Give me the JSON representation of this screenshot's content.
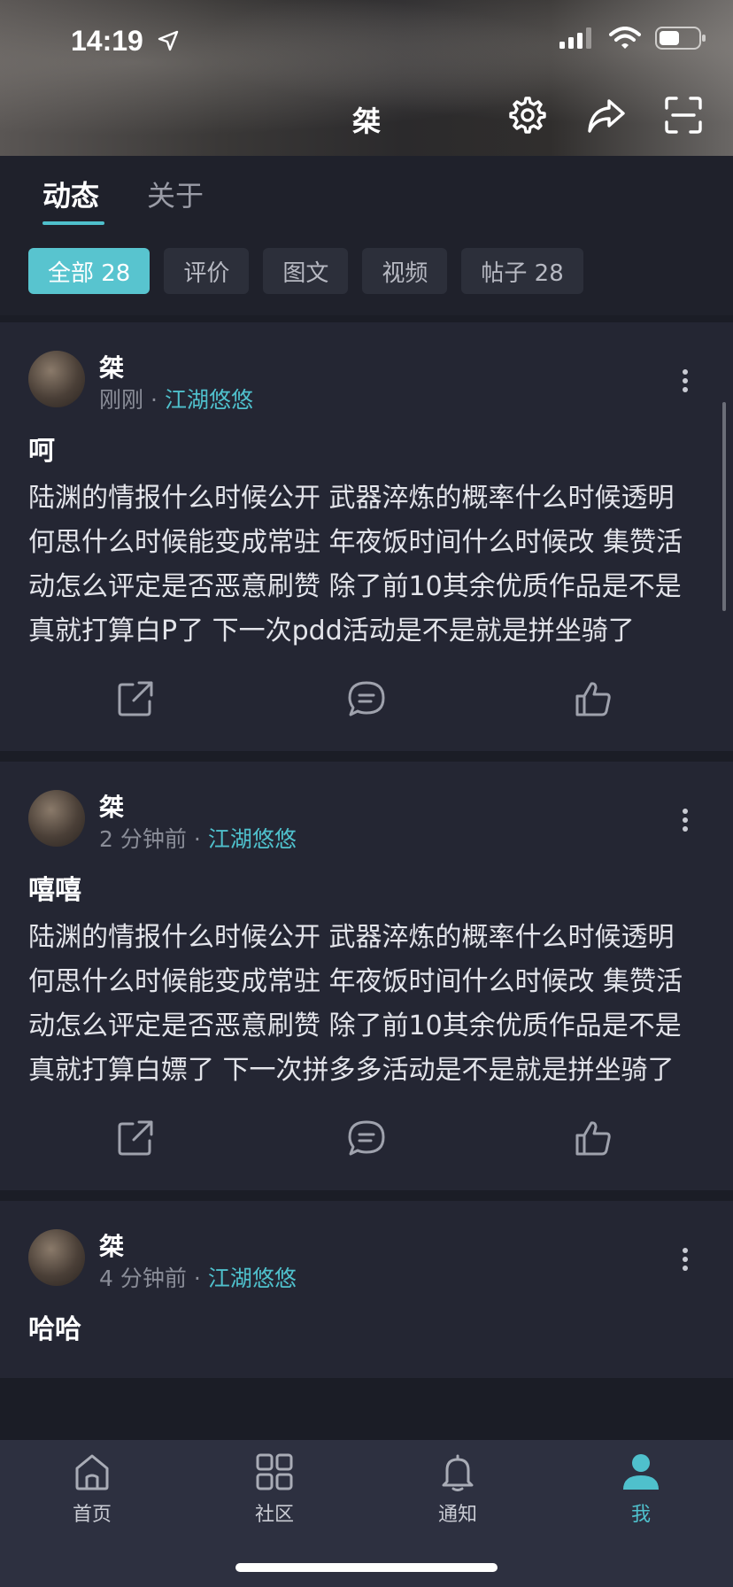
{
  "status_bar": {
    "time": "14:19"
  },
  "header": {
    "title": "桀"
  },
  "tabs": [
    {
      "label": "动态",
      "active": true
    },
    {
      "label": "关于",
      "active": false
    }
  ],
  "filter_chips": [
    {
      "label": "全部 28",
      "active": true
    },
    {
      "label": "评价",
      "active": false
    },
    {
      "label": "图文",
      "active": false
    },
    {
      "label": "视频",
      "active": false
    },
    {
      "label": "帖子 28",
      "active": false
    }
  ],
  "posts": [
    {
      "author": "桀",
      "time": "刚刚",
      "separator": "·",
      "tag": "江湖悠悠",
      "title": "呵",
      "body": "陆渊的情报什么时候公开 武器淬炼的概率什么时候透明 何思什么时候能变成常驻 年夜饭时间什么时候改 集赞活动怎么评定是否恶意刷赞 除了前10其余优质作品是不是真就打算白P了 下一次pdd活动是不是就是拼坐骑了"
    },
    {
      "author": "桀",
      "time": "2 分钟前",
      "separator": "·",
      "tag": "江湖悠悠",
      "title": "嘻嘻",
      "body": "陆渊的情报什么时候公开 武器淬炼的概率什么时候透明 何思什么时候能变成常驻 年夜饭时间什么时候改 集赞活动怎么评定是否恶意刷赞 除了前10其余优质作品是不是真就打算白嫖了 下一次拼多多活动是不是就是拼坐骑了"
    },
    {
      "author": "桀",
      "time": "4 分钟前",
      "separator": "·",
      "tag": "江湖悠悠",
      "title": "哈哈",
      "body": ""
    }
  ],
  "bottom_nav": [
    {
      "label": "首页",
      "icon": "home-icon",
      "active": false
    },
    {
      "label": "社区",
      "icon": "grid-icon",
      "active": false
    },
    {
      "label": "通知",
      "icon": "bell-icon",
      "active": false
    },
    {
      "label": "我",
      "icon": "profile-icon",
      "active": true
    }
  ],
  "colors": {
    "accent": "#4fc0cc",
    "background": "#1b1d26",
    "card": "#242633",
    "tabbar": "#2d3040"
  }
}
